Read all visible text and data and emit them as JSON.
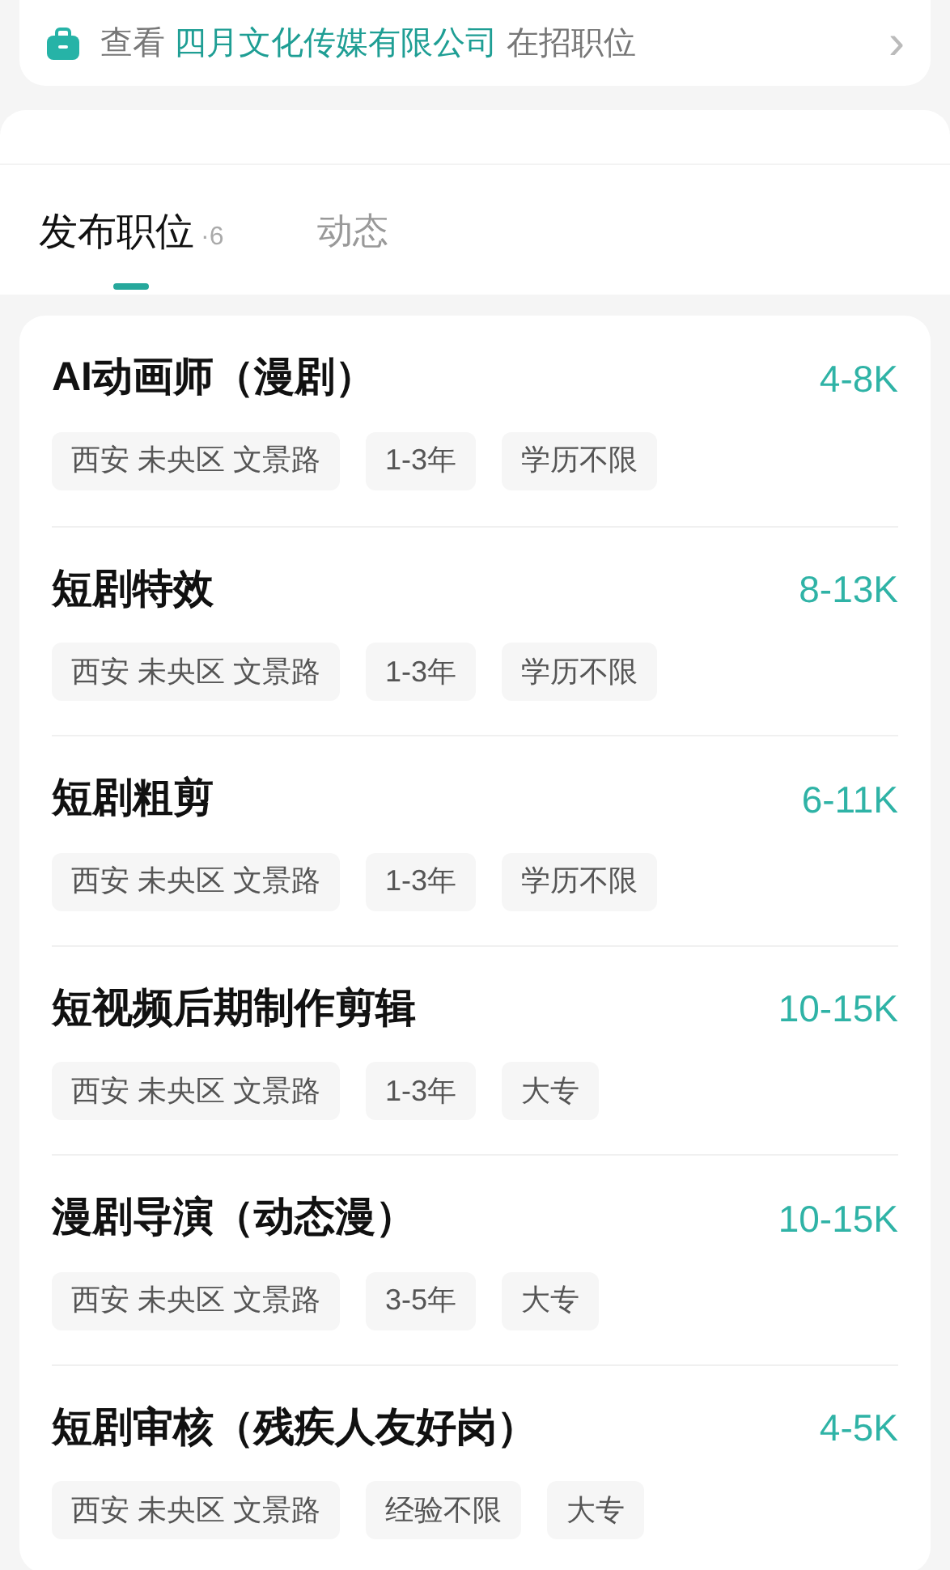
{
  "company_link": {
    "prefix": "查看",
    "company": "四月文化传媒有限公司",
    "suffix": "在招职位",
    "arrow": "›"
  },
  "tabs": [
    {
      "label": "发布职位",
      "count": "·6",
      "selected": true
    },
    {
      "label": "动态",
      "selected": false
    }
  ],
  "jobs": [
    {
      "title": "AI动画师（漫剧）",
      "salary": "4-8K",
      "tags": [
        "西安 未央区 文景路",
        "1-3年",
        "学历不限"
      ]
    },
    {
      "title": "短剧特效",
      "salary": "8-13K",
      "tags": [
        "西安 未央区 文景路",
        "1-3年",
        "学历不限"
      ]
    },
    {
      "title": "短剧粗剪",
      "salary": "6-11K",
      "tags": [
        "西安 未央区 文景路",
        "1-3年",
        "学历不限"
      ]
    },
    {
      "title": "短视频后期制作剪辑",
      "salary": "10-15K",
      "tags": [
        "西安 未央区 文景路",
        "1-3年",
        "大专"
      ]
    },
    {
      "title": "漫剧导演（动态漫）",
      "salary": "10-15K",
      "tags": [
        "西安 未央区 文景路",
        "3-5年",
        "大专"
      ]
    },
    {
      "title": "短剧审核（残疾人友好岗）",
      "salary": "4-5K",
      "tags": [
        "西安 未央区 文景路",
        "经验不限",
        "大专"
      ]
    }
  ]
}
